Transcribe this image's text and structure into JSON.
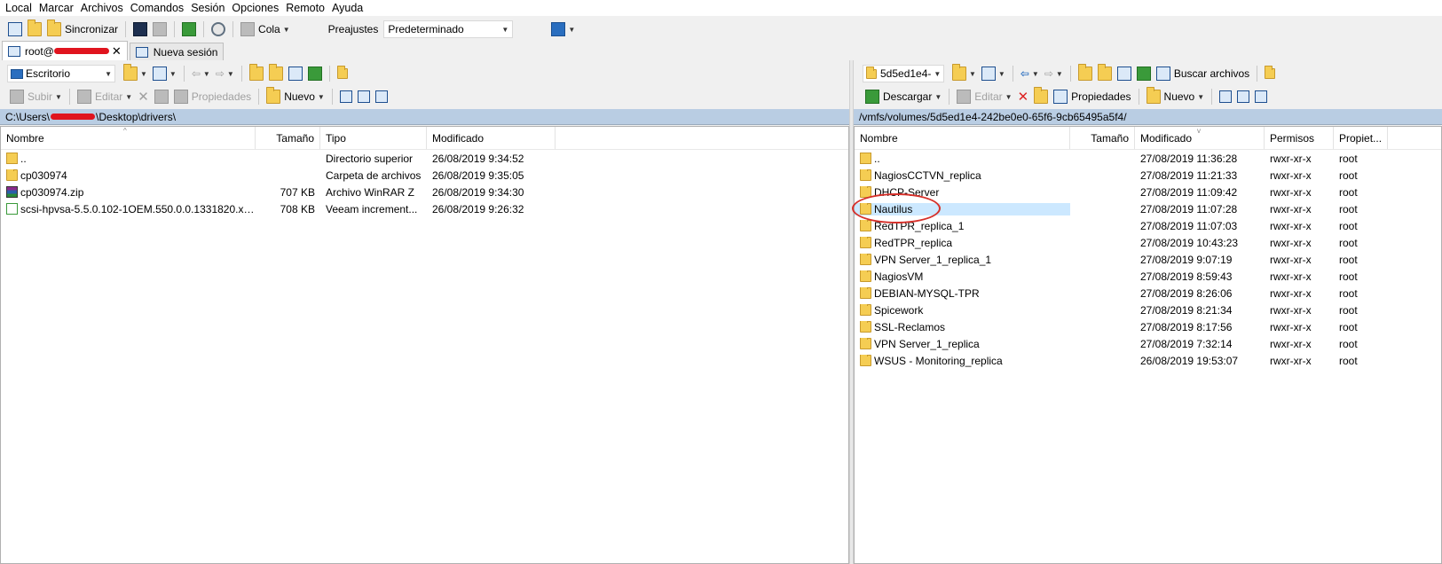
{
  "menu": [
    "Local",
    "Marcar",
    "Archivos",
    "Comandos",
    "Sesión",
    "Opciones",
    "Remoto",
    "Ayuda"
  ],
  "toolbar": {
    "sync_label": "Sincronizar",
    "queue_label": "Cola",
    "presets_label": "Preajustes",
    "presets_value": "Predeterminado"
  },
  "tabs": {
    "session_label": "root@",
    "new_session_label": "Nueva sesión"
  },
  "left": {
    "location": "Escritorio",
    "actions": {
      "upload": "Subir",
      "edit": "Editar",
      "properties": "Propiedades",
      "new": "Nuevo"
    },
    "path": {
      "prefix": "C:\\Users\\",
      "suffix": "\\Desktop\\drivers\\"
    },
    "columns": {
      "name": "Nombre",
      "size": "Tamaño",
      "type": "Tipo",
      "modified": "Modificado"
    },
    "rows": [
      {
        "name": "..",
        "size": "",
        "type": "Directorio superior",
        "modified": "26/08/2019  9:34:52",
        "icon": "up-folder-icon"
      },
      {
        "name": "cp030974",
        "size": "",
        "type": "Carpeta de archivos",
        "modified": "26/08/2019  9:35:05",
        "icon": "folder-icon"
      },
      {
        "name": "cp030974.zip",
        "size": "707 KB",
        "type": "Archivo WinRAR Z",
        "modified": "26/08/2019  9:34:30",
        "icon": "winrar-icon"
      },
      {
        "name": "scsi-hpvsa-5.5.0.102-1OEM.550.0.0.1331820.x86...",
        "size": "708 KB",
        "type": "Veeam increment...",
        "modified": "26/08/2019  9:26:32",
        "icon": "veeam-file-icon"
      }
    ]
  },
  "right": {
    "location": "5d5ed1e4-",
    "actions": {
      "download": "Descargar",
      "edit": "Editar",
      "properties": "Propiedades",
      "new": "Nuevo",
      "find": "Buscar archivos"
    },
    "path": "/vmfs/volumes/5d5ed1e4-242be0e0-65f6-9cb65495a5f4/",
    "columns": {
      "name": "Nombre",
      "size": "Tamaño",
      "modified": "Modificado",
      "perms": "Permisos",
      "owner": "Propiet..."
    },
    "rows": [
      {
        "name": "..",
        "modified": "27/08/2019 11:36:28",
        "perms": "rwxr-xr-x",
        "owner": "root"
      },
      {
        "name": "NagiosCCTVN_replica",
        "modified": "27/08/2019 11:21:33",
        "perms": "rwxr-xr-x",
        "owner": "root"
      },
      {
        "name": "DHCP-Server",
        "modified": "27/08/2019 11:09:42",
        "perms": "rwxr-xr-x",
        "owner": "root"
      },
      {
        "name": "Nautilus",
        "modified": "27/08/2019 11:07:28",
        "perms": "rwxr-xr-x",
        "owner": "root"
      },
      {
        "name": "RedTPR_replica_1",
        "modified": "27/08/2019 11:07:03",
        "perms": "rwxr-xr-x",
        "owner": "root"
      },
      {
        "name": "RedTPR_replica",
        "modified": "27/08/2019 10:43:23",
        "perms": "rwxr-xr-x",
        "owner": "root"
      },
      {
        "name": "VPN Server_1_replica_1",
        "modified": "27/08/2019 9:07:19",
        "perms": "rwxr-xr-x",
        "owner": "root"
      },
      {
        "name": "NagiosVM",
        "modified": "27/08/2019 8:59:43",
        "perms": "rwxr-xr-x",
        "owner": "root"
      },
      {
        "name": "DEBIAN-MYSQL-TPR",
        "modified": "27/08/2019 8:26:06",
        "perms": "rwxr-xr-x",
        "owner": "root"
      },
      {
        "name": "Spicework",
        "modified": "27/08/2019 8:21:34",
        "perms": "rwxr-xr-x",
        "owner": "root"
      },
      {
        "name": "SSL-Reclamos",
        "modified": "27/08/2019 8:17:56",
        "perms": "rwxr-xr-x",
        "owner": "root"
      },
      {
        "name": "VPN Server_1_replica",
        "modified": "27/08/2019 7:32:14",
        "perms": "rwxr-xr-x",
        "owner": "root"
      },
      {
        "name": "WSUS - Monitoring_replica",
        "modified": "26/08/2019 19:53:07",
        "perms": "rwxr-xr-x",
        "owner": "root"
      }
    ],
    "selected_index": 3
  },
  "colors": {
    "path_bar": "#b9cde3",
    "selection": "#cce8ff",
    "annotation": "#d6302a",
    "redaction": "#e0141e"
  }
}
